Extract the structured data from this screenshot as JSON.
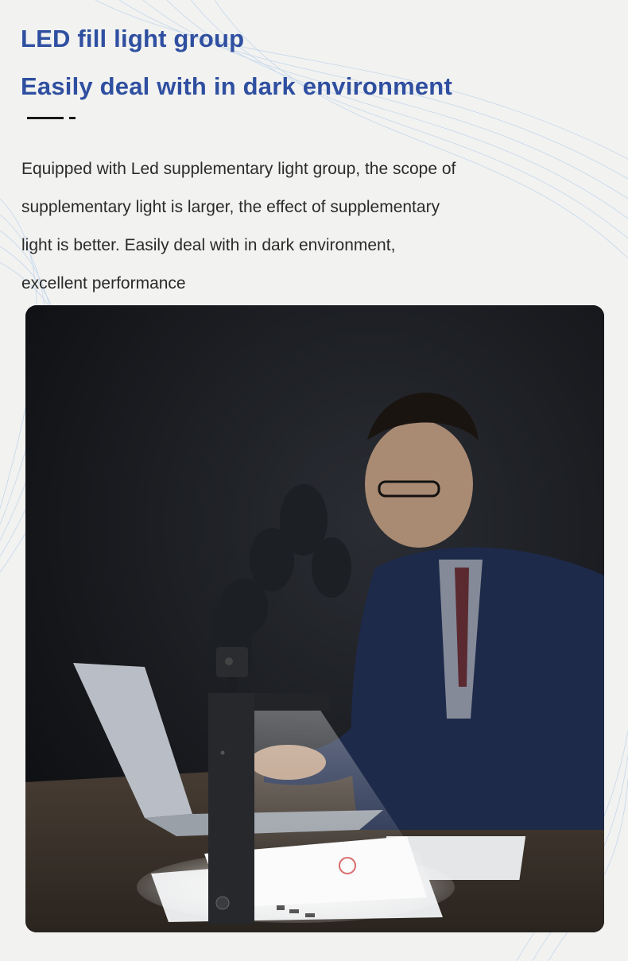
{
  "header": {
    "title_line1": "LED fill light group",
    "title_line2": "Easily deal with in dark environment"
  },
  "description": {
    "lines": [
      "Equipped with Led supplementary light group, the scope of",
      "supplementary light is larger, the effect of supplementary",
      "light is better. Easily deal with in dark environment,",
      "excellent performance"
    ]
  },
  "colors": {
    "title": "#2f4fa0",
    "body_text": "#2b2b2b",
    "background": "#f2f2f1",
    "wave_lines": "#9fc3e6"
  }
}
